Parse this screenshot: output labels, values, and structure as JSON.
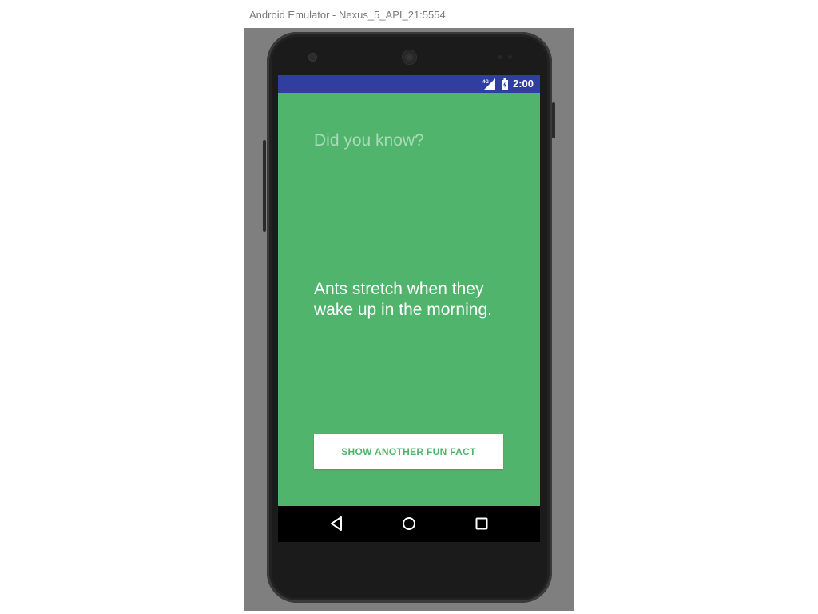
{
  "window": {
    "title": "Android Emulator - Nexus_5_API_21:5554"
  },
  "status_bar": {
    "network_label": "4G",
    "time": "2:00",
    "icons": [
      "signal-icon",
      "battery-icon"
    ]
  },
  "app": {
    "heading": "Did you know?",
    "fact": "Ants stretch when they wake up in the morning.",
    "button_label": "SHOW ANOTHER FUN FACT",
    "background_color": "#51b46d"
  },
  "nav_bar": {
    "buttons": [
      "back-icon",
      "home-icon",
      "recents-icon"
    ]
  },
  "colors": {
    "status_bar": "#303f9f",
    "screen_background": "#51b46d",
    "button_background": "#ffffff",
    "button_text": "#51b46d"
  }
}
